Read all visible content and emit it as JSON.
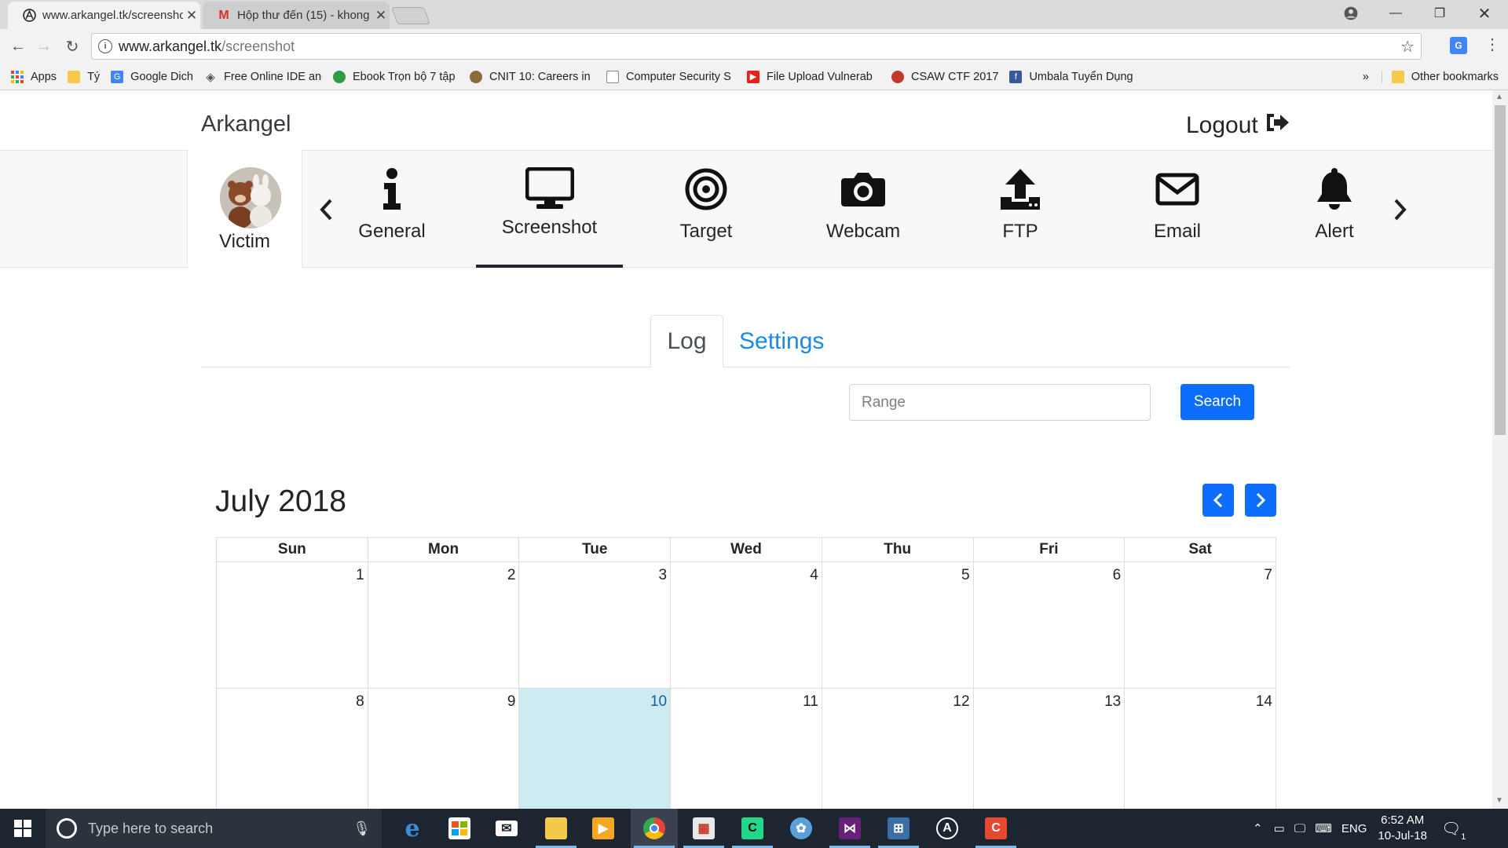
{
  "browser": {
    "tabs": [
      {
        "title": "www.arkangel.tk/screenshot"
      },
      {
        "title": "Hộp thư đến (15) - khong"
      }
    ],
    "url_domain": "www.arkangel.tk",
    "url_path": "/screenshot"
  },
  "bookmarks": [
    {
      "label": "Apps",
      "icon": "apps-grid-icon"
    },
    {
      "label": "Tý",
      "icon": "folder-icon"
    },
    {
      "label": "Google Dich",
      "icon": "google-translate-icon"
    },
    {
      "label": "Free Online IDE and",
      "icon": "ide-icon"
    },
    {
      "label": "Ebook Trọn bộ 7 tập",
      "icon": "leaf-icon"
    },
    {
      "label": "CNIT 10: Careers in",
      "icon": "user-icon"
    },
    {
      "label": "Computer Security S",
      "icon": "page-icon"
    },
    {
      "label": "File Upload Vulnerab",
      "icon": "youtube-icon"
    },
    {
      "label": "CSAW CTF 2017",
      "icon": "flag-icon"
    },
    {
      "label": "Umbala Tuyển Dụng",
      "icon": "facebook-icon"
    }
  ],
  "bookmarks_overflow": "»",
  "other_bookmarks": "Other bookmarks",
  "site": {
    "brand": "Arkangel",
    "logout": "Logout"
  },
  "victim_label": "Victim",
  "nav": [
    {
      "label": "General",
      "icon": "info-icon"
    },
    {
      "label": "Screenshot",
      "icon": "monitor-icon",
      "active": true
    },
    {
      "label": "Target",
      "icon": "target-icon"
    },
    {
      "label": "Webcam",
      "icon": "camera-icon"
    },
    {
      "label": "FTP",
      "icon": "upload-icon"
    },
    {
      "label": "Email",
      "icon": "envelope-icon"
    },
    {
      "label": "Alert",
      "icon": "bell-icon"
    }
  ],
  "page_tabs": {
    "log": "Log",
    "settings": "Settings"
  },
  "search": {
    "placeholder": "Range",
    "button": "Search"
  },
  "calendar": {
    "title": "July 2018",
    "weekdays": [
      "Sun",
      "Mon",
      "Tue",
      "Wed",
      "Thu",
      "Fri",
      "Sat"
    ],
    "weeks": [
      [
        "1",
        "2",
        "3",
        "4",
        "5",
        "6",
        "7"
      ],
      [
        "8",
        "9",
        "10",
        "11",
        "12",
        "13",
        "14"
      ]
    ],
    "today": "10"
  },
  "taskbar": {
    "search_placeholder": "Type here to search",
    "lang": "ENG",
    "time": "6:52 AM",
    "date": "10-Jul-18",
    "notifications": "1"
  },
  "colors": {
    "primary": "#0d6efd",
    "link": "#1e88e5",
    "today": "#cdebf0"
  }
}
